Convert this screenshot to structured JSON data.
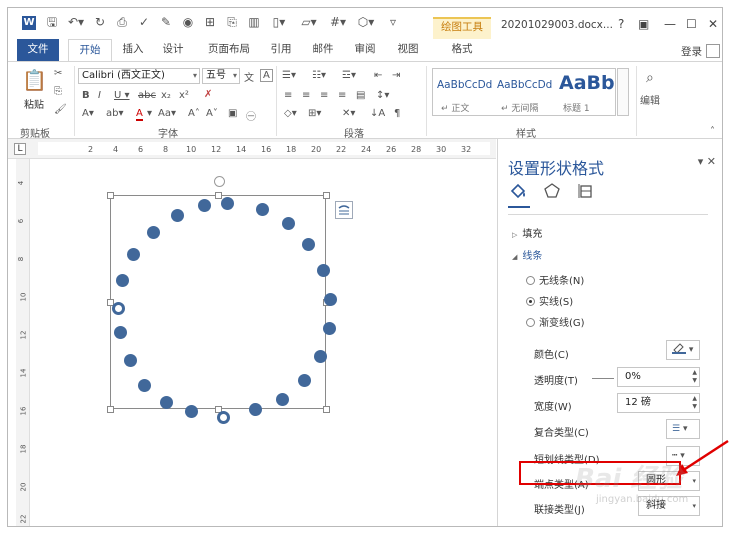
{
  "titlebar": {
    "contextual_tab": "绘图工具",
    "doc_title": "20201029003.docx...",
    "help": "?",
    "min": "—",
    "max": "☐",
    "close": "✕"
  },
  "tabs": [
    "文件",
    "开始",
    "插入",
    "设计",
    "页面布局",
    "引用",
    "邮件",
    "审阅",
    "视图",
    "格式"
  ],
  "login": "登录",
  "ribbon": {
    "clipboard": {
      "paste": "粘贴",
      "label": "剪贴板"
    },
    "font": {
      "name": "Calibri (西文正文)",
      "size": "五号",
      "label": "字体"
    },
    "paragraph": {
      "label": "段落"
    },
    "styles": {
      "items": [
        {
          "sample": "AaBbCcDd",
          "name": "↵ 正文"
        },
        {
          "sample": "AaBbCcDd",
          "name": "↵ 无间隔"
        },
        {
          "sample": "AaBb",
          "name": "标题 1"
        }
      ],
      "label": "样式"
    },
    "editing": {
      "label": "编辑"
    }
  },
  "ruler": {
    "corner": "L",
    "numbers": [
      "2",
      "4",
      "6",
      "8",
      "10",
      "12",
      "14",
      "16",
      "18",
      "20",
      "22",
      "24",
      "26",
      "28",
      "30",
      "32"
    ],
    "vnumbers": [
      "4",
      "6",
      "8",
      "10",
      "12",
      "14",
      "16",
      "18",
      "20",
      "22"
    ]
  },
  "pane": {
    "title": "设置形状格式",
    "fill": "填充",
    "line": "线条",
    "radios": [
      "无线条(N)",
      "实线(S)",
      "渐变线(G)"
    ],
    "selected_radio": 1,
    "props": {
      "color": "颜色(C)",
      "transparency": "透明度(T)",
      "transparency_value": "0%",
      "width": "宽度(W)",
      "width_value": "12 磅",
      "compound": "复合类型(C)",
      "dash": "短划线类型(D)",
      "cap": "端点类型(A)",
      "cap_value": "圆形",
      "join": "联接类型(J)",
      "join_value": "斜接"
    }
  },
  "watermark": {
    "text": "Bai 经验",
    "sub": "jingyan.baidu.com"
  },
  "colors": {
    "accent": "#2b579a",
    "dot": "#41689a",
    "highlight": "#e00000",
    "contextual": "#c77e0e"
  }
}
